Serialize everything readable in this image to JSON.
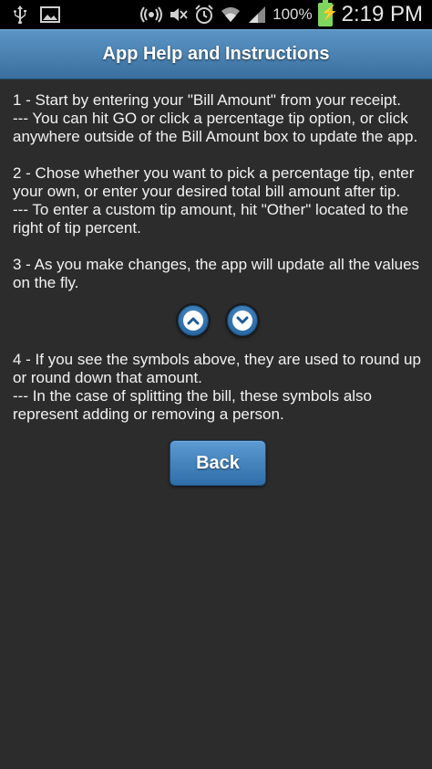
{
  "status_bar": {
    "icons_left": [
      "usb-icon",
      "image-icon"
    ],
    "icons_right": [
      "nfc-icon",
      "mute-icon",
      "alarm-icon",
      "wifi-icon",
      "signal-icon",
      "battery-icon"
    ],
    "battery_percent": "100%",
    "time": "2:19 PM"
  },
  "header": {
    "title": "App Help and Instructions"
  },
  "content": {
    "step1": "1 - Start by entering your \"Bill Amount\" from your receipt.\n--- You can hit GO or click a percentage tip option, or click anywhere outside of the Bill Amount box to update the app.",
    "step2": "2 - Chose whether you want to pick a percentage tip, enter your own, or enter your desired total bill amount after tip.\n--- To enter a custom tip amount, hit \"Other\" located to the right of tip percent.",
    "step3": "3 - As you make changes, the app will update all the values on the fly.",
    "step4": "4 - If you see the symbols above, they are used to round up or round down that amount.\n--- In the case of splitting the bill, these symbols also represent adding or removing a person."
  },
  "buttons": {
    "back_label": "Back"
  },
  "colors": {
    "header_top": "#5b95c5",
    "header_bottom": "#3a6f9f",
    "background": "#2c2c2c",
    "button_blue": "#3a78b2"
  }
}
